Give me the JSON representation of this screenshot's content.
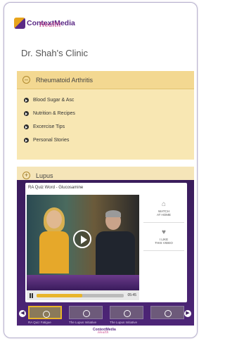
{
  "brand": {
    "name": "ContextMedia",
    "sub": "Health"
  },
  "clinic": {
    "title": "Dr. Shah's Clinic"
  },
  "accordion": {
    "open_section": "Rheumatoid Arthritis",
    "items": [
      "Blood Sugar & Asc",
      "Nutrition & Recipes",
      "Excercise Tips",
      "Personal Stories"
    ],
    "closed_section": "Lupus"
  },
  "player": {
    "title": "RA Quiz Word - Glucosamine",
    "progress": 0.52,
    "time": "05:45",
    "side": [
      {
        "icon": "house-icon",
        "label_line1": "WATCH",
        "label_line2": "AT HOME"
      },
      {
        "icon": "heart-icon",
        "label_line1": "I LIKE",
        "label_line2": "THIS VIDEO"
      }
    ]
  },
  "thumbnails": [
    {
      "caption": "RA Quiz Fatigue",
      "active": true
    },
    {
      "caption": "The Lupus Initiative",
      "active": false
    },
    {
      "caption": "The Lupus Initiative",
      "active": false
    },
    {
      "caption": "",
      "active": false
    }
  ],
  "footer": {
    "name": "ContextMedia",
    "sub": "Health"
  }
}
